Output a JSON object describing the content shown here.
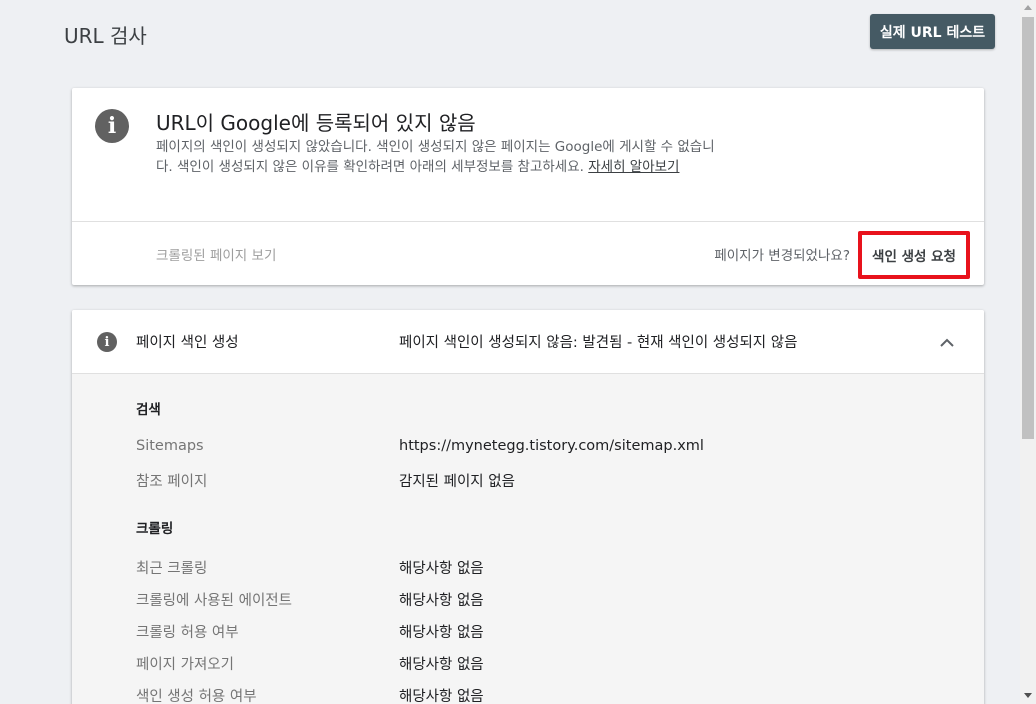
{
  "page": {
    "title": "URL 검사",
    "test_live_url_label": "실제 URL 테스트"
  },
  "status_card": {
    "icon": "info-icon",
    "title": "URL이 Google에 등록되어 있지 않음",
    "description": "페이지의 색인이 생성되지 않았습니다. 색인이 생성되지 않은 페이지는 Google에 게시할 수 없습니다. 색인이 생성되지 않은 이유를 확인하려면 아래의 세부정보를 참고하세요.",
    "learn_more": "자세히 알아보기",
    "view_crawled_page": "크롤링된 페이지 보기",
    "changed_question": "페이지가 변경되었나요?",
    "request_indexing": "색인 생성 요청",
    "highlight_color": "#e8121c"
  },
  "coverage": {
    "icon": "info-icon",
    "label": "페이지 색인 생성",
    "status": "페이지 색인이 생성되지 않음: 발견됨 - 현재 색인이 생성되지 않음",
    "collapse_icon": "chevron-up-icon",
    "sections": [
      {
        "heading": "검색",
        "rows": [
          {
            "label": "Sitemaps",
            "value": "https://mynetegg.tistory.com/sitemap.xml"
          },
          {
            "label": "참조 페이지",
            "value": "감지된 페이지 없음"
          }
        ]
      },
      {
        "heading": "크롤링",
        "rows": [
          {
            "label": "최근 크롤링",
            "value": "해당사항 없음"
          },
          {
            "label": "크롤링에 사용된 에이전트",
            "value": "해당사항 없음"
          },
          {
            "label": "크롤링 허용 여부",
            "value": "해당사항 없음"
          },
          {
            "label": "페이지 가져오기",
            "value": "해당사항 없음"
          },
          {
            "label": "색인 생성 허용 여부",
            "value": "해당사항 없음"
          }
        ]
      }
    ]
  }
}
